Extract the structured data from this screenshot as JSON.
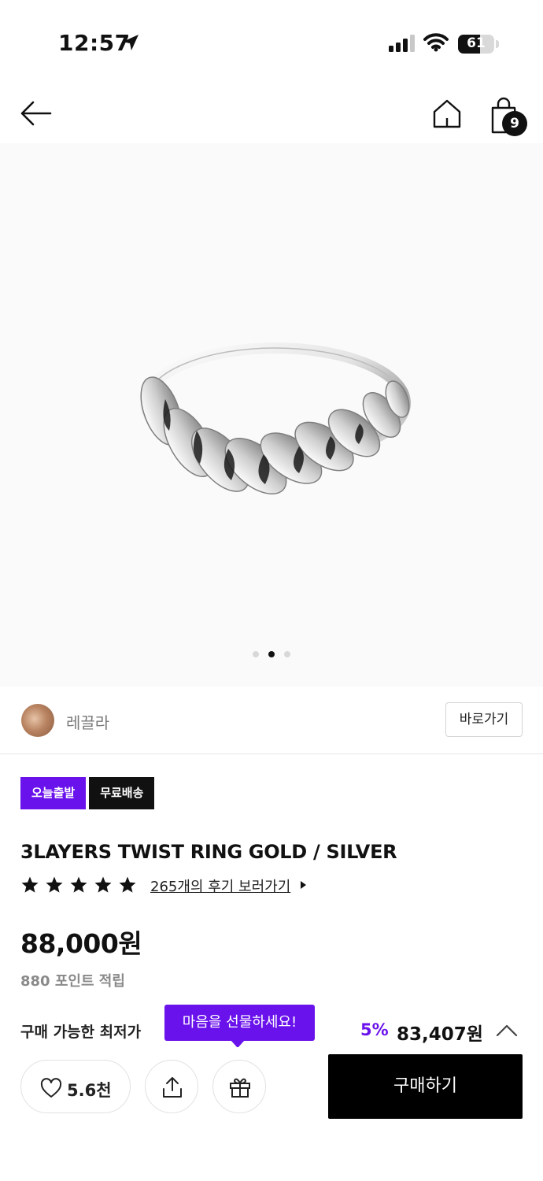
{
  "status_bar": {
    "time": "12:57",
    "battery": "61"
  },
  "nav": {
    "cart_count": "9"
  },
  "gallery": {
    "image_count": 3,
    "active_index": 1
  },
  "brand": {
    "name": "레끌라",
    "goto_label": "바로가기"
  },
  "tags": {
    "today_ship": "오늘출발",
    "free_ship": "무료배송"
  },
  "product": {
    "title": "3LAYERS TWIST RING GOLD / SILVER",
    "rating_stars": 5,
    "reviews_link": "265개의 후기 보러가기",
    "price": "88,000원",
    "points": "880 포인트 적립"
  },
  "lowest_price": {
    "label": "구매 가능한 최저가",
    "discount": "5%",
    "price": "83,407원"
  },
  "tooltip": {
    "text": "마음을 선물하세요!"
  },
  "action_bar": {
    "like_count": "5.6천",
    "buy_label": "구매하기"
  },
  "colors": {
    "accent": "#6a12ec",
    "dark": "#111111"
  },
  "icons": [
    "location-arrow-icon",
    "signal-icon",
    "wifi-icon",
    "battery-icon",
    "back-arrow-icon",
    "home-icon",
    "shopping-bag-icon",
    "star-icon",
    "caret-right-icon",
    "chevron-up-icon",
    "heart-icon",
    "share-icon",
    "gift-icon"
  ]
}
